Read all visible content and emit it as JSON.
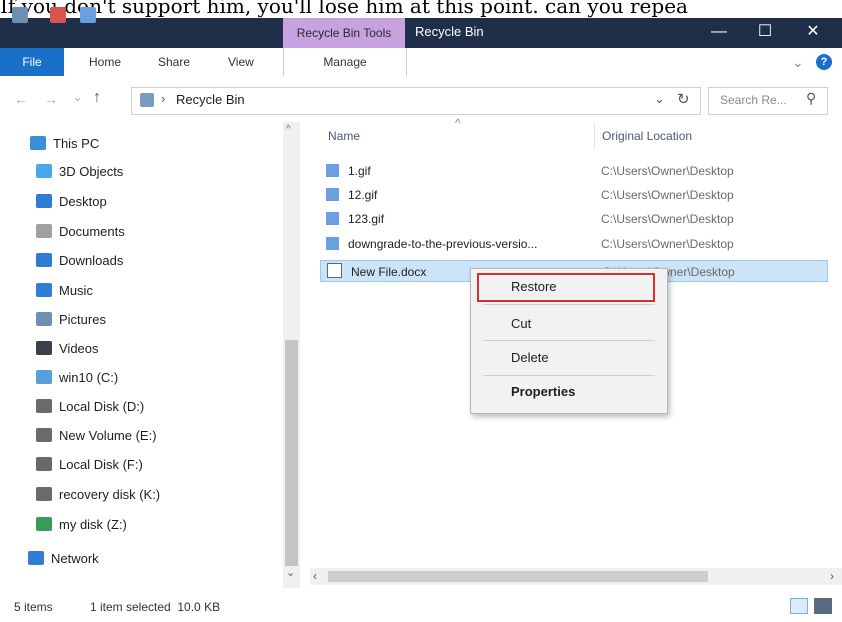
{
  "overlay_caption": "If you don't support him, you'll lose him at this point. can you repea",
  "window": {
    "contextual_tab": "Recycle Bin Tools",
    "title": "Recycle Bin",
    "minimize": "—",
    "maximize": "☐",
    "close": "✕"
  },
  "ribbon": {
    "tabs": [
      "File",
      "Home",
      "Share",
      "View"
    ],
    "manage": "Manage",
    "collapse": "⌄",
    "help": "?"
  },
  "address": {
    "path": "Recycle Bin",
    "separator": "›",
    "dropdown": "⌄",
    "refresh": "↻",
    "search_placeholder": "Search Re...",
    "search_icon": "⚲"
  },
  "nav": {
    "items": [
      {
        "label": "This PC",
        "icon": "computer-icon",
        "color": "#3a8fd9"
      },
      {
        "label": "3D Objects",
        "icon": "cube-icon",
        "color": "#48a8e8"
      },
      {
        "label": "Desktop",
        "icon": "desktop-icon",
        "color": "#2f7cd3"
      },
      {
        "label": "Documents",
        "icon": "documents-icon",
        "color": "#a0a0a0"
      },
      {
        "label": "Downloads",
        "icon": "download-icon",
        "color": "#2f7cd3"
      },
      {
        "label": "Music",
        "icon": "music-icon",
        "color": "#2f7cd3"
      },
      {
        "label": "Pictures",
        "icon": "pictures-icon",
        "color": "#6f8fb0"
      },
      {
        "label": "Videos",
        "icon": "videos-icon",
        "color": "#3a3f4a"
      },
      {
        "label": "win10 (C:)",
        "icon": "system-drive-icon",
        "color": "#5aa0d8"
      },
      {
        "label": "Local Disk (D:)",
        "icon": "drive-icon",
        "color": "#6a6a6a"
      },
      {
        "label": "New Volume (E:)",
        "icon": "drive-icon",
        "color": "#6a6a6a"
      },
      {
        "label": "Local Disk (F:)",
        "icon": "drive-icon",
        "color": "#6a6a6a"
      },
      {
        "label": "recovery disk (K:)",
        "icon": "drive-icon",
        "color": "#6a6a6a"
      },
      {
        "label": "my disk (Z:)",
        "icon": "usb-drive-icon",
        "color": "#3a9a5a"
      },
      {
        "label": "Network",
        "icon": "network-icon",
        "color": "#2f7cd3"
      }
    ]
  },
  "list": {
    "col_name": "Name",
    "col_location": "Original Location",
    "sort_indicator": "^",
    "files": [
      {
        "name": "1.gif",
        "location": "C:\\Users\\Owner\\Desktop"
      },
      {
        "name": "12.gif",
        "location": "C:\\Users\\Owner\\Desktop"
      },
      {
        "name": "123.gif",
        "location": "C:\\Users\\Owner\\Desktop"
      },
      {
        "name": "downgrade-to-the-previous-versio...",
        "location": "C:\\Users\\Owner\\Desktop"
      },
      {
        "name": "New File.docx",
        "location": "C:\\Users\\Owner\\Desktop"
      }
    ]
  },
  "context_menu": {
    "restore": "Restore",
    "cut": "Cut",
    "delete": "Delete",
    "properties": "Properties"
  },
  "status": {
    "items": "5 items",
    "selected": "1 item selected  10.0 KB"
  }
}
